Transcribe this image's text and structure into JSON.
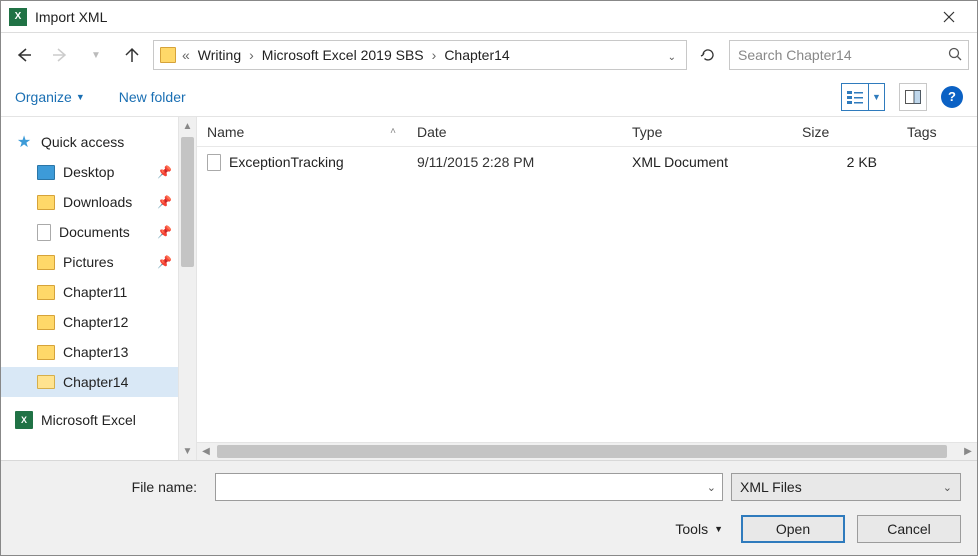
{
  "window": {
    "title": "Import XML"
  },
  "breadcrumb": {
    "items": [
      "Writing",
      "Microsoft Excel 2019 SBS",
      "Chapter14"
    ]
  },
  "search": {
    "placeholder": "Search Chapter14"
  },
  "toolbar": {
    "organize": "Organize",
    "new_folder": "New folder"
  },
  "sidebar": {
    "quick_access": "Quick access",
    "items": [
      {
        "label": "Desktop",
        "pinned": true
      },
      {
        "label": "Downloads",
        "pinned": true
      },
      {
        "label": "Documents",
        "pinned": true,
        "icon": "doc"
      },
      {
        "label": "Pictures",
        "pinned": true
      },
      {
        "label": "Chapter11",
        "pinned": false
      },
      {
        "label": "Chapter12",
        "pinned": false
      },
      {
        "label": "Chapter13",
        "pinned": false
      },
      {
        "label": "Chapter14",
        "pinned": false,
        "selected": true,
        "open": true
      }
    ],
    "excel": "Microsoft Excel"
  },
  "columns": {
    "name": "Name",
    "date": "Date",
    "type": "Type",
    "size": "Size",
    "tags": "Tags"
  },
  "files": [
    {
      "name": "ExceptionTracking",
      "date": "9/11/2015 2:28 PM",
      "type": "XML Document",
      "size": "2 KB"
    }
  ],
  "footer": {
    "file_name_label": "File name:",
    "file_name_value": "",
    "filter": "XML Files",
    "tools": "Tools",
    "open": "Open",
    "cancel": "Cancel"
  }
}
